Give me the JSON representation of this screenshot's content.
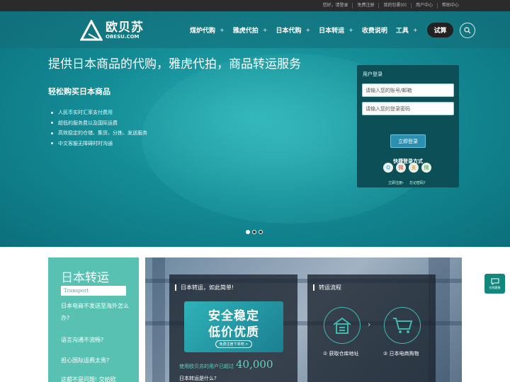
{
  "topbar": {
    "links": [
      "您好，请登录",
      "免费注册",
      "我的包裹(0)",
      "用户中心",
      "帮助中心"
    ]
  },
  "nav": {
    "logo_cn": "欧贝苏",
    "logo_en": "OBESU.COM",
    "menu": [
      {
        "label": "煤炉代购"
      },
      {
        "label": "雅虎代拍"
      },
      {
        "label": "日本代购"
      },
      {
        "label": "日本转运"
      },
      {
        "label": "收费说明"
      },
      {
        "label": "工具"
      }
    ],
    "try_label": "试算"
  },
  "hero": {
    "title": "提供日本商品的代购，雅虎代拍，商品转运服务",
    "subtitle": "轻松购买日本商品",
    "features": [
      "人民币实时汇率支付费用",
      "超低的服务费以及国际运费",
      "高效稳定的仓储、集货、分拣、发送服务",
      "中文客服无障碍时时沟通"
    ]
  },
  "login": {
    "title": "用户登录",
    "account_placeholder": "请输入您的账号/邮箱",
    "password_placeholder": "请输入您的登录密码",
    "button": "立即登录",
    "quick_title": "快捷登录方式",
    "register_link": "立即注册›",
    "forgot_link": "忘记密码?",
    "quick_icons": [
      "qq-icon",
      "weibo-icon",
      "alipay-icon",
      "wechat-icon"
    ],
    "quick_glyphs": [
      "Q",
      "微",
      "支",
      "微"
    ]
  },
  "sidebar": {
    "title": "日本转运",
    "subtitle_en": "Transport",
    "items": [
      "日本电商不发送至海外怎么办?",
      "语言沟通不流畅?",
      "担心国际运费太贵?",
      "这都不是问题! 交给欧"
    ]
  },
  "panel_a": {
    "title": "日本转运，如此简单!",
    "promo_line1": "安全稳定",
    "promo_line2": "低价优质",
    "promo_button": "免费注册下单吧 >",
    "stat_prefix": "使用欧贝苏的用户已超过",
    "stat_number": "40,000",
    "question": "日本转运是什么?"
  },
  "panel_b": {
    "title": "转运流程",
    "steps": [
      "① 获取仓库地址",
      "② 日本电商购物"
    ]
  },
  "float_service": {
    "label": "在线客服"
  },
  "colors": {
    "hero_teal": "#148c96",
    "login_panel": "#0d4f56",
    "sidebar_teal": "#58c1b2",
    "accent_green": "#5fd1c2"
  }
}
